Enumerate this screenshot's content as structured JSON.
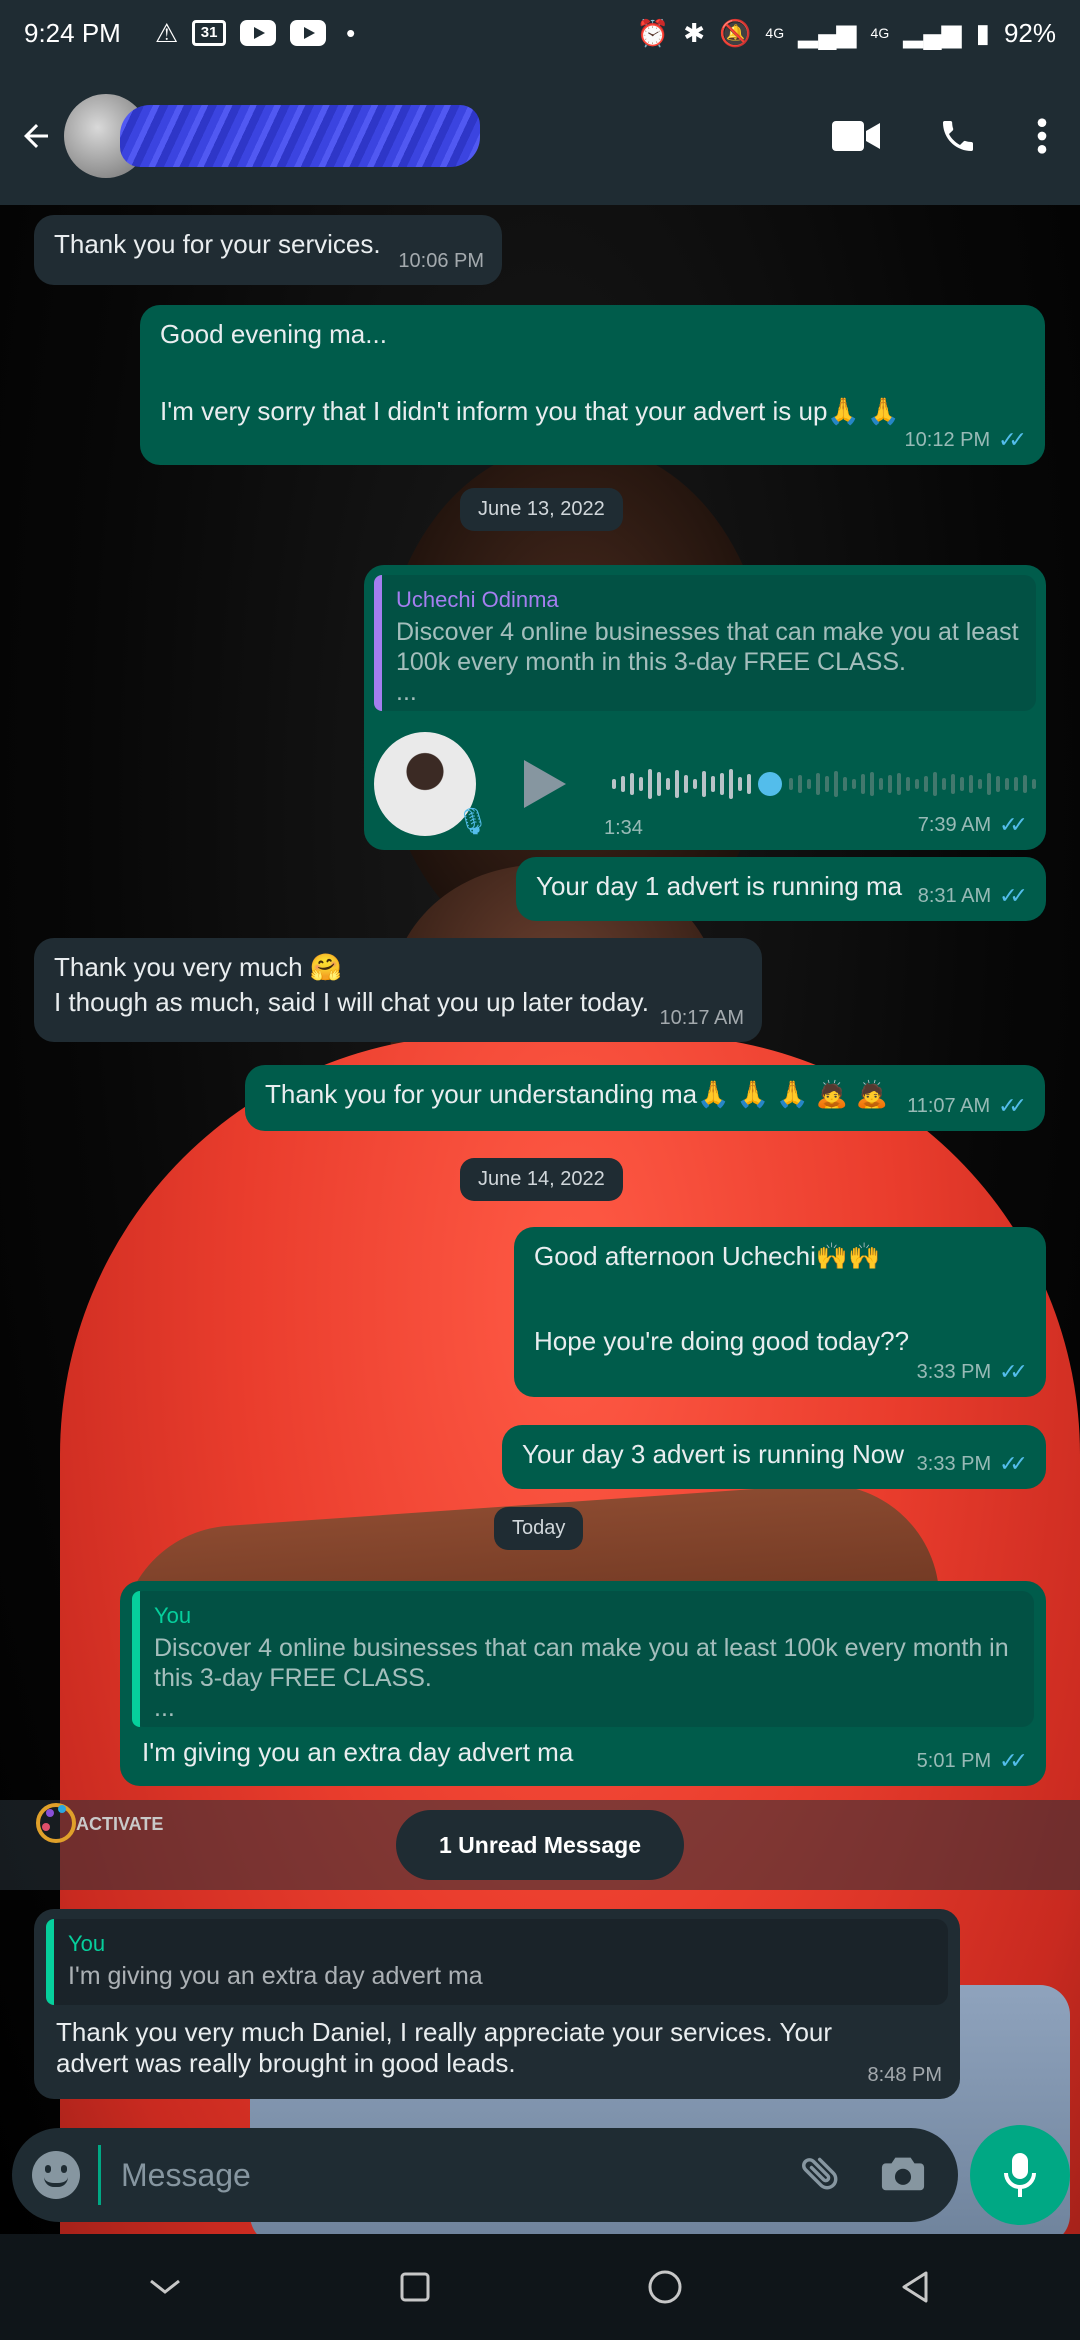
{
  "status_bar": {
    "time": "9:24 PM",
    "calendar_day": "31",
    "network_1": "4G",
    "network_2": "4G",
    "battery": "92%"
  },
  "header": {
    "icons": [
      "back-arrow-icon",
      "video-call-icon",
      "phone-icon",
      "more-vert-icon"
    ]
  },
  "messages": [
    {
      "dir": "in",
      "text": "Thank you for your services.",
      "time": "10:06 PM"
    },
    {
      "dir": "out",
      "text_1": "Good evening ma...",
      "text_2": "I'm very sorry that I didn't inform you that your advert is up🙏 🙏",
      "time": "10:12 PM"
    },
    {
      "dir": "out",
      "voice": true,
      "quote_author": "Uchechi Odinma",
      "quote_text": "Discover 4 online businesses that can make you at least 100k every month in this 3-day FREE CLASS.",
      "quote_more": "...",
      "duration": "1:34",
      "time": "7:39 AM"
    },
    {
      "dir": "out",
      "text": "Your day 1 advert is running ma",
      "time": "8:31 AM"
    },
    {
      "dir": "in",
      "text_1": "Thank you very much 🤗",
      "text_2": "I though as much, said I will chat you up later today.",
      "time": "10:17 AM"
    },
    {
      "dir": "out",
      "text": "Thank you for your understanding ma🙏 🙏 🙏 🙇 🙇",
      "time": "11:07 AM"
    },
    {
      "dir": "out",
      "text_1": "Good afternoon Uchechi🙌🙌",
      "text_2": "Hope you're doing good today??",
      "time": "3:33 PM"
    },
    {
      "dir": "out",
      "text": "Your day 3 advert is running Now",
      "time": "3:33 PM"
    },
    {
      "dir": "out",
      "quote_author": "You",
      "quote_text": "Discover 4 online businesses that can make you at least 100k every month in this 3-day FREE CLASS.",
      "quote_more": "...",
      "text": "I'm giving you an extra day advert ma",
      "time": "5:01 PM"
    },
    {
      "dir": "in",
      "quote_author": "You",
      "quote_text": "I'm giving you an extra day advert ma",
      "text": "Thank you very much Daniel, I really appreciate your services. Your advert was really brought in good leads.",
      "time": "8:48 PM"
    }
  ],
  "date_chips": [
    "June 13, 2022",
    "June 14, 2022",
    "Today"
  ],
  "unread_banner": "1 Unread Message",
  "watermark": "ACTIVATE",
  "composer": {
    "placeholder": "Message"
  },
  "colors": {
    "outgoing": "#005c4b",
    "incoming": "#202c33",
    "accent": "#00a884",
    "read_ticks": "#53bdeb"
  }
}
